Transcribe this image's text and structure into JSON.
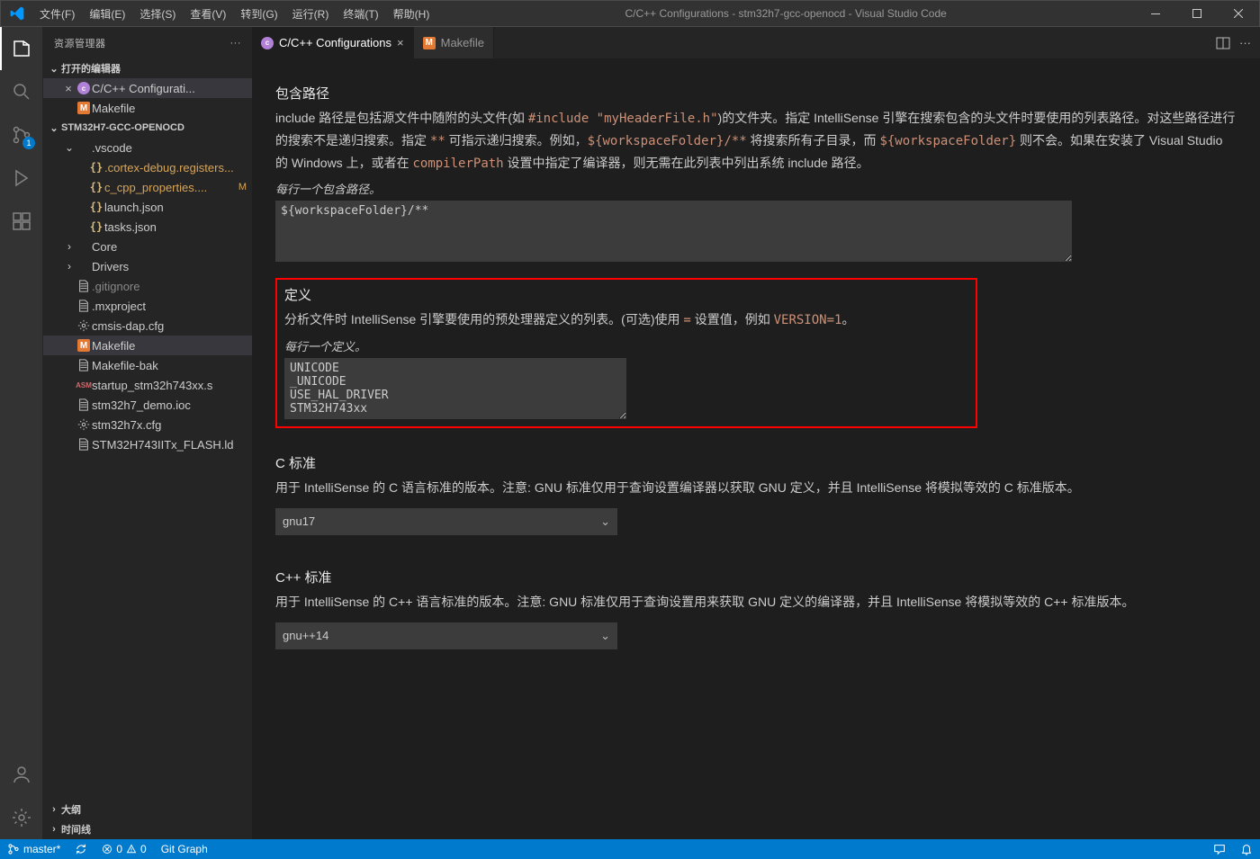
{
  "menus": [
    "文件(F)",
    "编辑(E)",
    "选择(S)",
    "查看(V)",
    "转到(G)",
    "运行(R)",
    "终端(T)",
    "帮助(H)"
  ],
  "windowTitle": "C/C++ Configurations - stm32h7-gcc-openocd - Visual Studio Code",
  "sidebarTitle": "资源管理器",
  "openEditorsLabel": "打开的编辑器",
  "openEditors": [
    {
      "label": "C/C++ Configurati...",
      "icon": "purple",
      "close": true
    },
    {
      "label": "Makefile",
      "icon": "m"
    }
  ],
  "projectName": "STM32H7-GCC-OPENOCD",
  "tree": [
    {
      "label": ".vscode",
      "kind": "folder",
      "open": true,
      "indent": 0
    },
    {
      "label": ".cortex-debug.registers...",
      "kind": "json",
      "indent": 1,
      "cls": "yellow"
    },
    {
      "label": "c_cpp_properties....",
      "kind": "json",
      "indent": 1,
      "cls": "yellow",
      "mod": "M"
    },
    {
      "label": "launch.json",
      "kind": "json",
      "indent": 1
    },
    {
      "label": "tasks.json",
      "kind": "json",
      "indent": 1
    },
    {
      "label": "Core",
      "kind": "folder",
      "open": false,
      "indent": 0
    },
    {
      "label": "Drivers",
      "kind": "folder",
      "open": false,
      "indent": 0
    },
    {
      "label": ".gitignore",
      "kind": "file",
      "indent": 0,
      "cls": "gray"
    },
    {
      "label": ".mxproject",
      "kind": "file",
      "indent": 0
    },
    {
      "label": "cmsis-dap.cfg",
      "kind": "gear",
      "indent": 0
    },
    {
      "label": "Makefile",
      "kind": "m",
      "indent": 0,
      "active": true
    },
    {
      "label": "Makefile-bak",
      "kind": "file",
      "indent": 0
    },
    {
      "label": "startup_stm32h743xx.s",
      "kind": "asm",
      "indent": 0
    },
    {
      "label": "stm32h7_demo.ioc",
      "kind": "file",
      "indent": 0
    },
    {
      "label": "stm32h7x.cfg",
      "kind": "gear",
      "indent": 0
    },
    {
      "label": "STM32H743IITx_FLASH.ld",
      "kind": "file",
      "indent": 0
    }
  ],
  "outlineLabel": "大纲",
  "timelineLabel": "时间线",
  "tabs": [
    {
      "label": "C/C++ Configurations",
      "icon": "purple",
      "active": true,
      "close": true
    },
    {
      "label": "Makefile",
      "icon": "m",
      "active": false
    }
  ],
  "sections": {
    "includeTitle": "包含路径",
    "includeDesc1a": "include 路径是包括源文件中随附的头文件(如 ",
    "includeDesc1code": "#include \"myHeaderFile.h\"",
    "includeDesc1b": ")的文件夹。指定 IntelliSense 引擎在搜索包含的头文件时要使用的列表路径。对这些路径进行的搜索不是递归搜索。指定 ",
    "includeDesc1code2": "**",
    "includeDesc1c": " 可指示递归搜索。例如，",
    "includeDesc1code3": "${workspaceFolder}/**",
    "includeDesc1d": " 将搜索所有子目录，而 ",
    "includeDesc1code4": "${workspaceFolder}",
    "includeDesc1e": " 则不会。如果在安装了 Visual Studio 的 Windows 上，或者在 ",
    "includeDesc1code5": "compilerPath",
    "includeDesc1f": " 设置中指定了编译器，则无需在此列表中列出系统 include 路径。",
    "includeHint": "每行一个包含路径。",
    "includeValue": "${workspaceFolder}/**",
    "definesTitle": "定义",
    "definesDesc1": "分析文件时 IntelliSense 引擎要使用的预处理器定义的列表。(可选)使用 ",
    "definesCode1": "=",
    "definesDesc2": " 设置值，例如 ",
    "definesCode2": "VERSION=1",
    "definesDesc3": "。",
    "definesHint": "每行一个定义。",
    "definesValue": "UNICODE\n_UNICODE\nUSE_HAL_DRIVER\nSTM32H743xx",
    "cStdTitle": "C 标准",
    "cStdDesc": "用于 IntelliSense 的 C 语言标准的版本。注意: GNU 标准仅用于查询设置编译器以获取 GNU 定义，并且 IntelliSense 将模拟等效的 C 标准版本。",
    "cStdValue": "gnu17",
    "cppStdTitle": "C++ 标准",
    "cppStdDesc": "用于 IntelliSense 的 C++ 语言标准的版本。注意: GNU 标准仅用于查询设置用来获取 GNU 定义的编译器，并且 IntelliSense 将模拟等效的 C++ 标准版本。",
    "cppStdValue": "gnu++14"
  },
  "status": {
    "branch": "master*",
    "errors": "0",
    "warnings": "0",
    "gitGraph": "Git Graph"
  },
  "scmBadge": "1"
}
